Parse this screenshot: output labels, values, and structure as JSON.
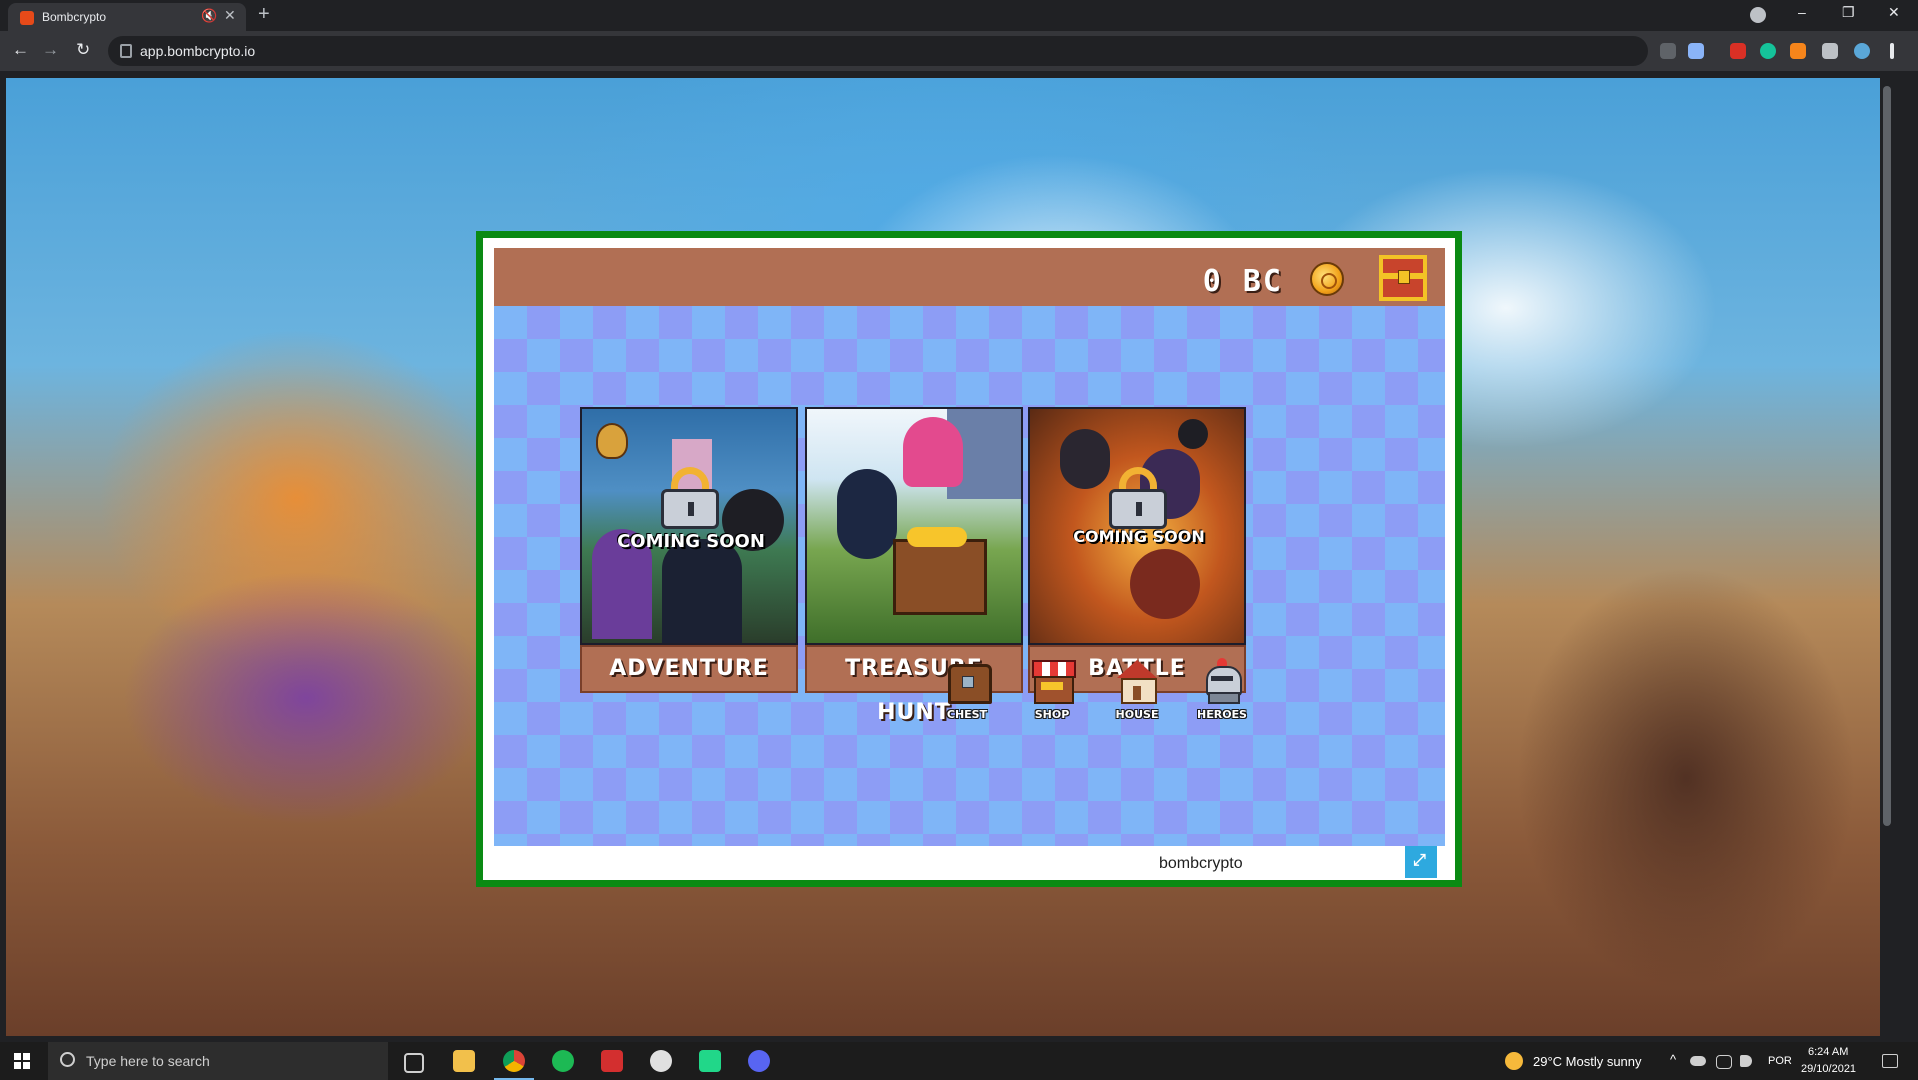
{
  "browser": {
    "tab_title": "Bombcrypto",
    "tab_mute_icon": "🔇",
    "tab_close_icon": "✕",
    "new_tab_icon": "+",
    "url": "app.bombcrypto.io",
    "back_icon": "←",
    "forward_icon": "→",
    "reload_icon": "↻",
    "minimize_icon": "–",
    "restore_icon": "❐",
    "close_icon": "✕"
  },
  "game": {
    "balance": "0 BC",
    "modes": [
      {
        "label": "ADVENTURE",
        "status": "COMING SOON"
      },
      {
        "label": "TREASURE HUNT",
        "status": ""
      },
      {
        "label": "BATTLE",
        "status": "COMING SOON"
      }
    ],
    "menu": [
      {
        "label": "CHEST"
      },
      {
        "label": "SHOP"
      },
      {
        "label": "HOUSE"
      },
      {
        "label": "HEROES"
      }
    ],
    "footer_label": "bombcrypto",
    "fullscreen_icon": "⤢"
  },
  "taskbar": {
    "search_placeholder": "Type here to search",
    "weather": "29°C  Mostly sunny",
    "language": "POR",
    "time": "6:24 AM",
    "date": "29/10/2021"
  }
}
